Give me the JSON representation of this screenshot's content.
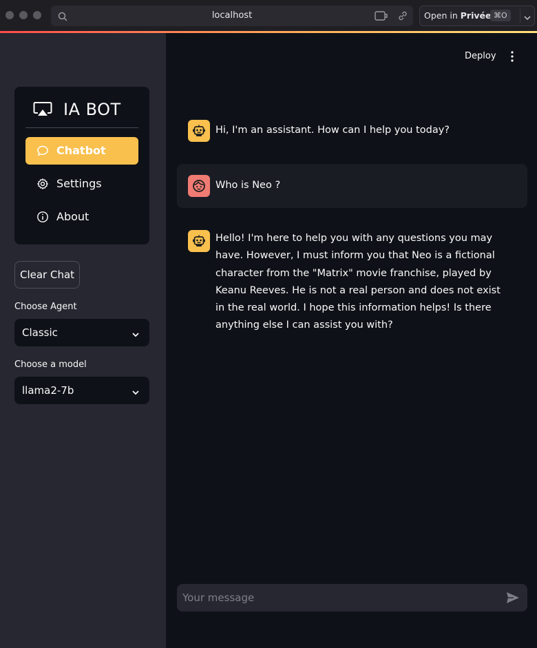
{
  "browser": {
    "url": "localhost",
    "open_in_prefix": "Open in",
    "open_in_target": "Privée",
    "shortcut": "⌘O"
  },
  "sidebar": {
    "brand": "IA BOT",
    "menu": [
      {
        "label": "Chatbot",
        "icon": "chat-bubble-icon",
        "active": true
      },
      {
        "label": "Settings",
        "icon": "gear-icon",
        "active": false
      },
      {
        "label": "About",
        "icon": "info-icon",
        "active": false
      }
    ],
    "clear_button": "Clear Chat",
    "agent_label": "Choose Agent",
    "agent_value": "Classic",
    "model_label": "Choose a model",
    "model_value": "llama2-7b"
  },
  "header": {
    "deploy": "Deploy"
  },
  "messages": [
    {
      "role": "assistant",
      "text": "Hi, I'm an assistant. How can I help you today?"
    },
    {
      "role": "user",
      "text": "Who is Neo ?"
    },
    {
      "role": "assistant",
      "text": "Hello! I'm here to help you with any questions you may have. However, I must inform you that Neo is a fictional character from the \"Matrix\" movie franchise, played by Keanu Reeves. He is not a real person and does not exist in the real world. I hope this information helps! Is there anything else I can assist you with?"
    }
  ],
  "chat_input": {
    "placeholder": "Your message"
  },
  "colors": {
    "accent": "#f9c04e",
    "user_avatar": "#f07b73",
    "sidebar_bg": "#262730",
    "main_bg": "#0e1117"
  }
}
